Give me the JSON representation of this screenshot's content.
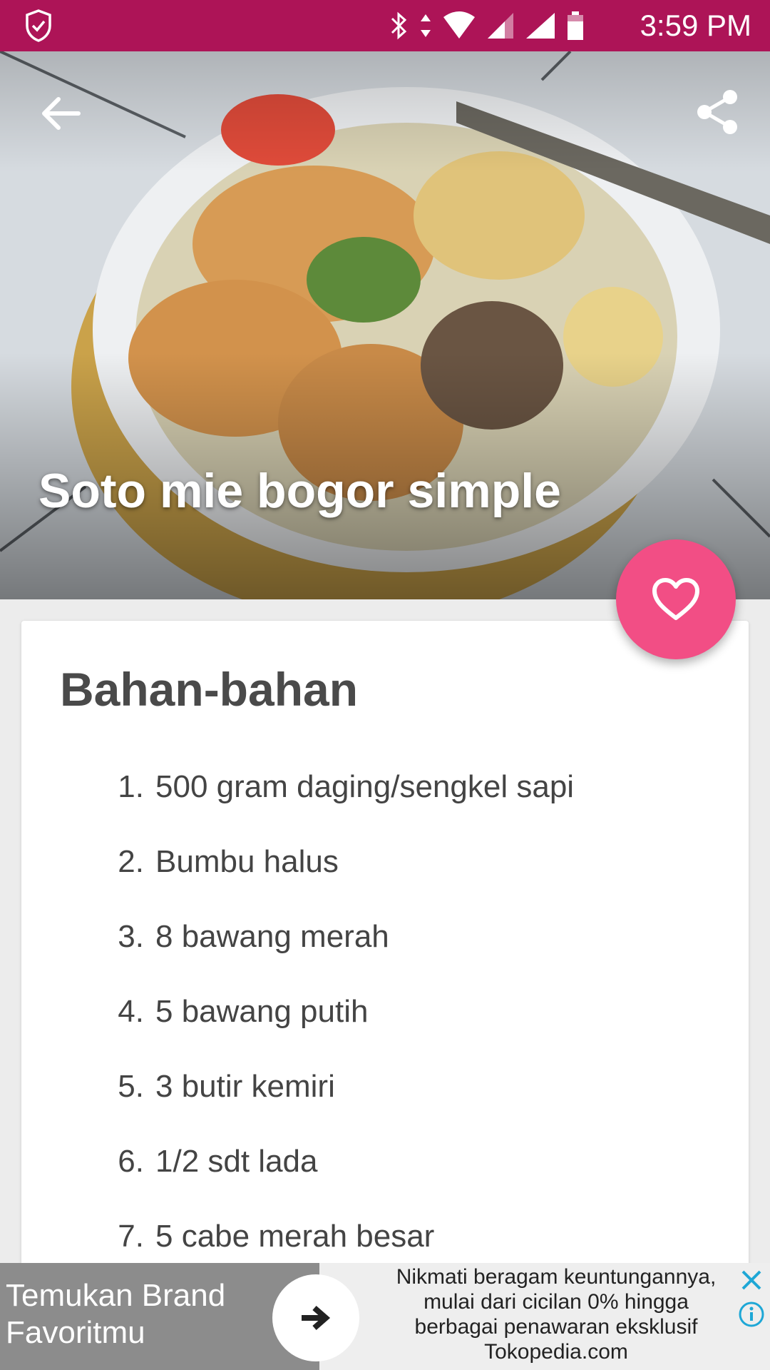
{
  "status_bar": {
    "time": "3:59 PM",
    "icons": [
      "shield-check-icon",
      "bluetooth-icon",
      "data-arrows-icon",
      "wifi-icon",
      "signal-icon",
      "signal-icon",
      "battery-icon"
    ]
  },
  "hero": {
    "title": "Soto mie bogor simple",
    "back_icon": "arrow-back-icon",
    "share_icon": "share-icon"
  },
  "fab": {
    "icon": "heart-outline-icon",
    "color": "#f24e85"
  },
  "ingredients": {
    "heading": "Bahan-bahan",
    "items": [
      {
        "num": "1.",
        "text": "500 gram daging/sengkel sapi"
      },
      {
        "num": "2.",
        "text": "Bumbu halus"
      },
      {
        "num": "3.",
        "text": "8 bawang merah"
      },
      {
        "num": "4.",
        "text": "5 bawang putih"
      },
      {
        "num": "5.",
        "text": "3 butir kemiri"
      },
      {
        "num": "6.",
        "text": "1/2 sdt lada"
      },
      {
        "num": "7.",
        "text": "5 cabe merah besar"
      }
    ]
  },
  "ad": {
    "headline": "Temukan Brand Favoritmu",
    "body_line1": "Nikmati beragam keuntungannya,",
    "body_line2": "mulai dari cicilan 0% hingga",
    "body_line3": "berbagai penawaran eksklusif",
    "body_line4": "Tokopedia.com",
    "close_icon": "close-x-icon",
    "info_icon": "info-icon"
  },
  "colors": {
    "status_bar": "#ad1457",
    "accent": "#f24e85",
    "text_dark": "#4a4a4a"
  }
}
